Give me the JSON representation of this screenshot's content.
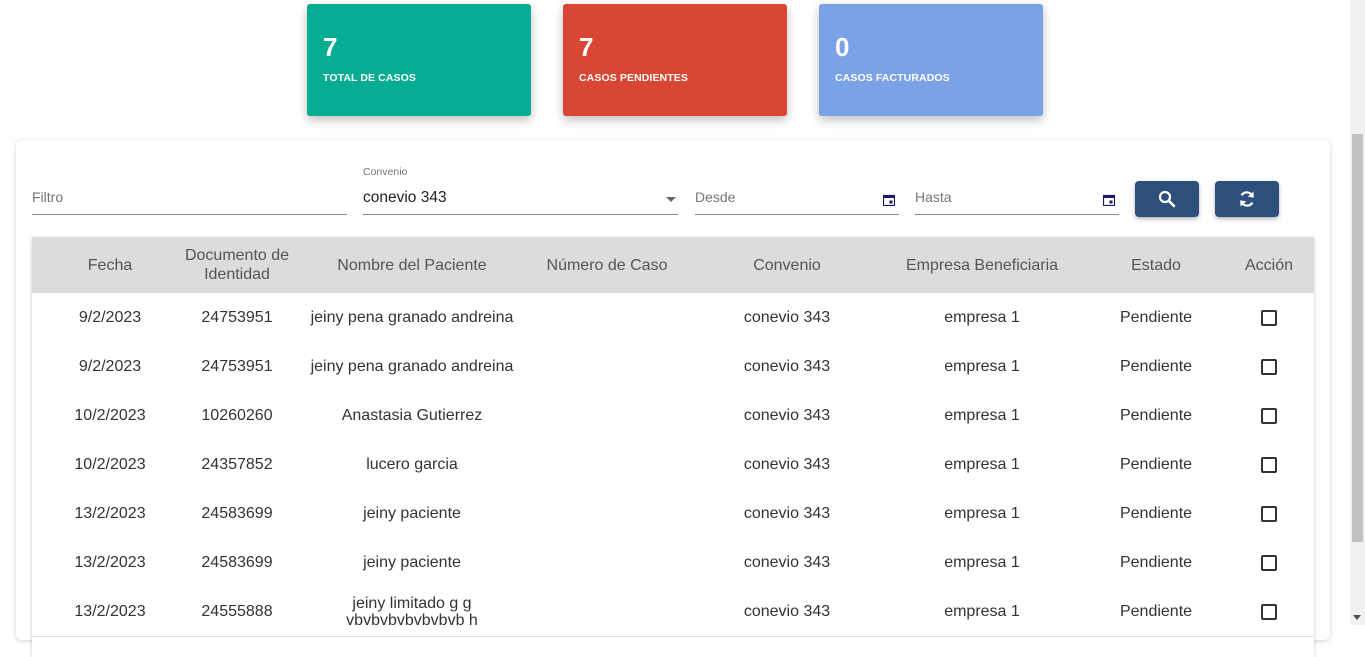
{
  "stats": [
    {
      "value": "7",
      "label": "TOTAL DE CASOS",
      "color": "#06ad92"
    },
    {
      "value": "7",
      "label": "CASOS PENDIENTES",
      "color": "#d94634"
    },
    {
      "value": "0",
      "label": "CASOS FACTURADOS",
      "color": "#7ba1e6"
    }
  ],
  "filters": {
    "filtro_placeholder": "Filtro",
    "convenio_label": "Convenio",
    "convenio_value": "conevio 343",
    "desde_placeholder": "Desde",
    "hasta_placeholder": "Hasta"
  },
  "buttons": {
    "search_icon": "search-icon",
    "refresh_icon": "refresh-icon",
    "accent": "#2c4f7c"
  },
  "table": {
    "headers": [
      "Fecha",
      "Documento de Identidad",
      "Nombre del Paciente",
      "Número de Caso",
      "Convenio",
      "Empresa Beneficiaria",
      "Estado",
      "Acción"
    ],
    "rows": [
      {
        "fecha": "9/2/2023",
        "documento": "24753951",
        "nombre": "jeiny pena granado andreina",
        "caso": "",
        "convenio": "conevio 343",
        "empresa": "empresa 1",
        "estado": "Pendiente"
      },
      {
        "fecha": "9/2/2023",
        "documento": "24753951",
        "nombre": "jeiny pena granado andreina",
        "caso": "",
        "convenio": "conevio 343",
        "empresa": "empresa 1",
        "estado": "Pendiente"
      },
      {
        "fecha": "10/2/2023",
        "documento": "10260260",
        "nombre": "Anastasia Gutierrez",
        "caso": "",
        "convenio": "conevio 343",
        "empresa": "empresa 1",
        "estado": "Pendiente"
      },
      {
        "fecha": "10/2/2023",
        "documento": "24357852",
        "nombre": "lucero garcia",
        "caso": "",
        "convenio": "conevio 343",
        "empresa": "empresa 1",
        "estado": "Pendiente"
      },
      {
        "fecha": "13/2/2023",
        "documento": "24583699",
        "nombre": "jeiny paciente",
        "caso": "",
        "convenio": "conevio 343",
        "empresa": "empresa 1",
        "estado": "Pendiente"
      },
      {
        "fecha": "13/2/2023",
        "documento": "24583699",
        "nombre": "jeiny paciente",
        "caso": "",
        "convenio": "conevio 343",
        "empresa": "empresa 1",
        "estado": "Pendiente"
      },
      {
        "fecha": "13/2/2023",
        "documento": "24555888",
        "nombre": "jeiny limitado g g vbvbvbvbvbvbvb h",
        "caso": "",
        "convenio": "conevio 343",
        "empresa": "empresa 1",
        "estado": "Pendiente"
      }
    ]
  }
}
